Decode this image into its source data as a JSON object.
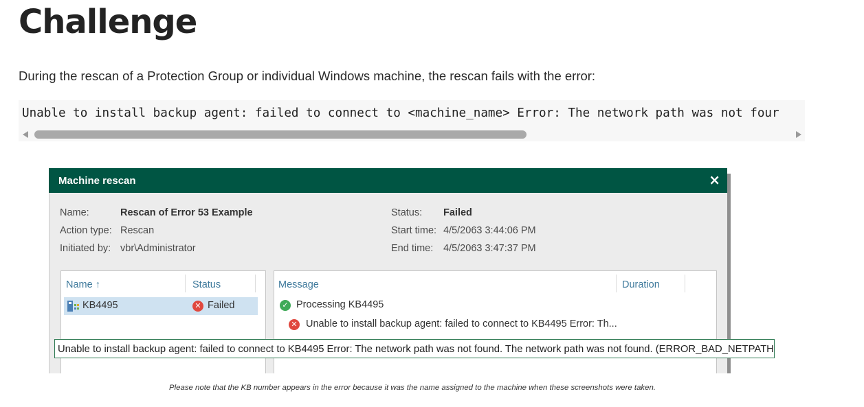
{
  "heading": "Challenge",
  "intro_text": "During the rescan of a Protection Group or individual Windows machine, the rescan fails with the error:",
  "code_line": "Unable to install backup agent: failed to connect to <machine_name> Error: The network path was not four",
  "dialog": {
    "title": "Machine rescan",
    "close_glyph": "×",
    "name_label": "Name:",
    "name_value": "Rescan of Error 53 Example",
    "action_type_label": "Action type:",
    "action_type_value": "Rescan",
    "initiated_by_label": "Initiated by:",
    "initiated_by_value": "vbr\\Administrator",
    "status_label": "Status:",
    "status_value": "Failed",
    "start_time_label": "Start time:",
    "start_time_value": "4/5/2063 3:44:06 PM",
    "end_time_label": "End time:",
    "end_time_value": "4/5/2063 3:47:37 PM",
    "left_table": {
      "columns": [
        "Name",
        "Status"
      ],
      "sort_glyph": "↑",
      "rows": [
        {
          "name": "KB4495",
          "status": "Failed"
        }
      ]
    },
    "right_table": {
      "columns": [
        "Message",
        "Duration"
      ],
      "rows": [
        {
          "message": "Processing KB4495",
          "status_icon": "success-icon"
        },
        {
          "message": "Unable to install backup agent: failed to connect to KB4495 Error: Th...",
          "status_icon": "error-icon"
        }
      ]
    },
    "tooltip": "Unable to install backup agent: failed to connect to KB4495 Error: The network path was not found. The network path was not found. (ERROR_BAD_NETPATH)."
  },
  "caption": "Please note that the KB number appears in the error because it was the name assigned to the machine when these screenshots were taken.",
  "colors": {
    "titlebar": "#005543",
    "tooltip_border": "#2e7a52",
    "error_red": "#e0483e",
    "success_green": "#3faa58",
    "column_header_blue": "#3f7a9c",
    "selection_blue": "#cfe2f1"
  }
}
